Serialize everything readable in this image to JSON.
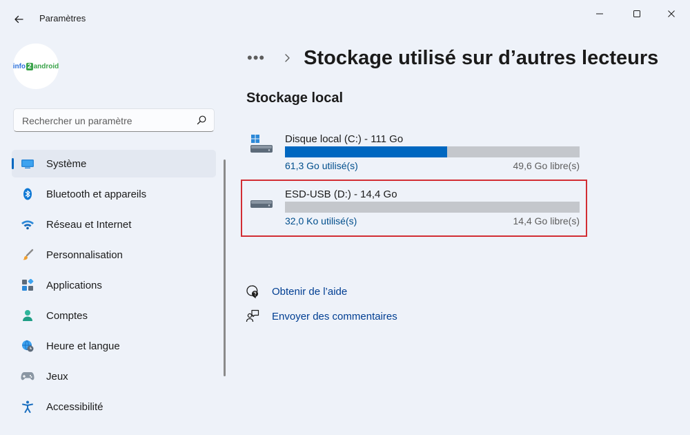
{
  "window": {
    "title": "Paramètres"
  },
  "profile": {
    "logo": {
      "part1": "info",
      "part2": "2",
      "part3": "android"
    }
  },
  "search": {
    "placeholder": "Rechercher un paramètre"
  },
  "sidebar": {
    "items": [
      {
        "label": "Système",
        "icon": "monitor-icon",
        "active": true
      },
      {
        "label": "Bluetooth et appareils",
        "icon": "bluetooth-icon"
      },
      {
        "label": "Réseau et Internet",
        "icon": "wifi-icon"
      },
      {
        "label": "Personnalisation",
        "icon": "paintbrush-icon"
      },
      {
        "label": "Applications",
        "icon": "apps-icon"
      },
      {
        "label": "Comptes",
        "icon": "person-icon"
      },
      {
        "label": "Heure et langue",
        "icon": "globe-clock-icon"
      },
      {
        "label": "Jeux",
        "icon": "gamepad-icon"
      },
      {
        "label": "Accessibilité",
        "icon": "accessibility-icon"
      }
    ]
  },
  "breadcrumb": {
    "more": "•••",
    "title": "Stockage utilisé sur d’autres lecteurs"
  },
  "section": {
    "title": "Stockage local"
  },
  "drives": [
    {
      "name": "Disque local (C:) - 111 Go",
      "used": "61,3 Go utilisé(s)",
      "free": "49,6 Go libre(s)",
      "fill_fraction": 0.55,
      "icon": "system-drive-icon"
    },
    {
      "name": "ESD-USB (D:) - 14,4 Go",
      "used": "32,0 Ko utilisé(s)",
      "free": "14,4 Go libre(s)",
      "fill_fraction": 0.0,
      "icon": "usb-drive-icon",
      "highlighted": true
    }
  ],
  "links": {
    "help": "Obtenir de l’aide",
    "feedback": "Envoyer des commentaires"
  },
  "colors": {
    "accent": "#0067c0",
    "highlight_border": "#d22d33",
    "link": "#003e92"
  }
}
